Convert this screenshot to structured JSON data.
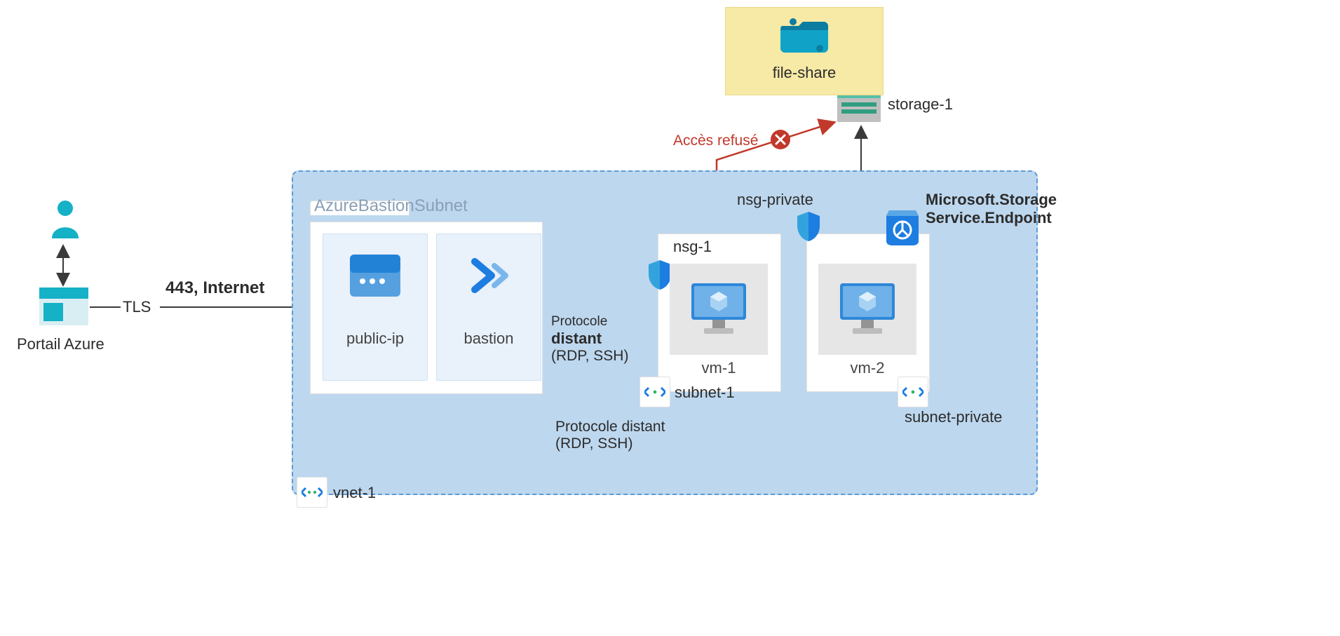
{
  "portal": {
    "label": "Portail Azure",
    "tls": "TLS"
  },
  "port_label": "443, Internet",
  "bastion_subnet": {
    "label": "AzureBastionSubnet"
  },
  "public_ip": {
    "label": "public-ip"
  },
  "bastion": {
    "label": "bastion"
  },
  "remote_proto": {
    "line1": "Protocole",
    "line2": "distant",
    "line3": "(RDP, SSH)"
  },
  "remote_proto2": {
    "line1": "Protocole distant",
    "line2": "(RDP, SSH)"
  },
  "nsg1": {
    "label": "nsg-1"
  },
  "nsg_private": {
    "label": "nsg-private"
  },
  "vm1": {
    "label": "vm-1"
  },
  "vm2": {
    "label": "vm-2"
  },
  "subnet1": {
    "label": "subnet-1"
  },
  "subnet_private": {
    "label": "subnet-private"
  },
  "vnet": {
    "label": "vnet-1"
  },
  "access_denied": "Accès refusé",
  "service_endpoint": {
    "line1": "Microsoft.Storage",
    "line2": "Service.Endpoint"
  },
  "storage": {
    "label": "storage-1"
  },
  "fileshare": {
    "label": "file-share"
  }
}
